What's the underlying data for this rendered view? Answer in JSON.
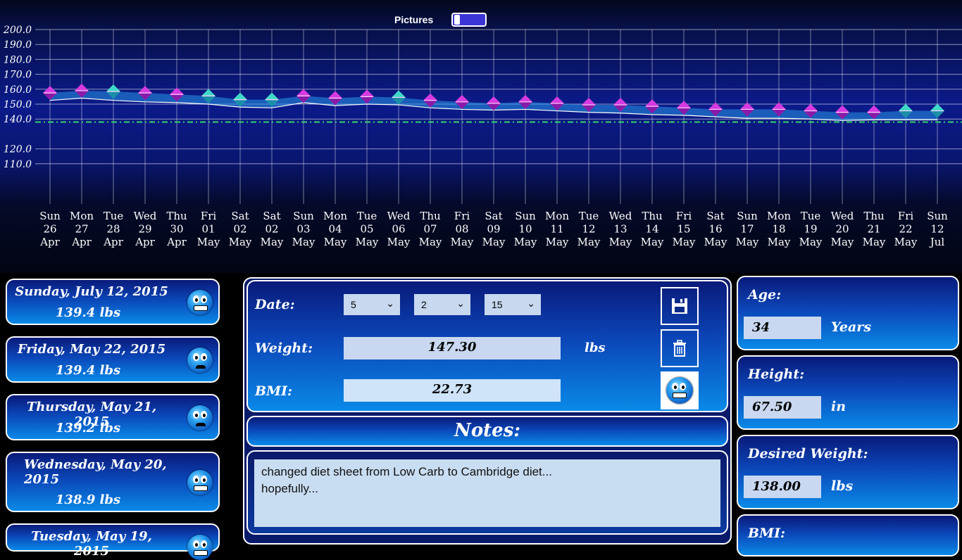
{
  "toolbar": {
    "pictures_label": "Pictures",
    "pictures_on": false
  },
  "chart_data": {
    "type": "line",
    "title": "",
    "xlabel": "",
    "ylabel": "",
    "ylim": [
      100,
      200
    ],
    "yticks": [
      "200.0",
      "190.0",
      "180.0",
      "170.0",
      "160.0",
      "150.0",
      "140.0",
      "120.0",
      "110.0"
    ],
    "target": 138,
    "grid": true,
    "categories": [
      [
        "Sun",
        "26",
        "Apr"
      ],
      [
        "Mon",
        "27",
        "Apr"
      ],
      [
        "Tue",
        "28",
        "Apr"
      ],
      [
        "Wed",
        "29",
        "Apr"
      ],
      [
        "Thu",
        "30",
        "Apr"
      ],
      [
        "Fri",
        "01",
        "May"
      ],
      [
        "Sat",
        "02",
        "May"
      ],
      [
        "Sat",
        "02",
        "May"
      ],
      [
        "Sun",
        "03",
        "May"
      ],
      [
        "Mon",
        "04",
        "May"
      ],
      [
        "Tue",
        "05",
        "May"
      ],
      [
        "Wed",
        "06",
        "May"
      ],
      [
        "Thu",
        "07",
        "May"
      ],
      [
        "Fri",
        "08",
        "May"
      ],
      [
        "Sat",
        "09",
        "May"
      ],
      [
        "Sun",
        "10",
        "May"
      ],
      [
        "Mon",
        "11",
        "May"
      ],
      [
        "Tue",
        "12",
        "May"
      ],
      [
        "Wed",
        "13",
        "May"
      ],
      [
        "Thu",
        "14",
        "May"
      ],
      [
        "Fri",
        "15",
        "May"
      ],
      [
        "Sat",
        "16",
        "May"
      ],
      [
        "Sun",
        "17",
        "May"
      ],
      [
        "Mon",
        "18",
        "May"
      ],
      [
        "Tue",
        "19",
        "May"
      ],
      [
        "Wed",
        "20",
        "May"
      ],
      [
        "Thu",
        "21",
        "May"
      ],
      [
        "Fri",
        "22",
        "May"
      ],
      [
        "Sun",
        "12",
        "Jul"
      ]
    ],
    "series": [
      {
        "values": [
          157.5,
          159,
          158.5,
          157.5,
          156.5,
          155.5,
          153,
          153,
          155.5,
          154,
          155,
          154.5,
          152.5,
          151.5,
          150.5,
          151.5,
          150.5,
          149.5,
          149.5,
          148.5,
          147.5,
          146.5,
          146.5,
          146.5,
          145.5,
          144.5,
          144.5,
          145.5,
          145.5
        ]
      }
    ],
    "trend": [
      152.5,
      154,
      152.5,
      151.5,
      151,
      150,
      148,
      147.5,
      151,
      149,
      150,
      149.5,
      147.5,
      146.5,
      146,
      146.5,
      145.5,
      144.5,
      144,
      143,
      142.5,
      141.5,
      140.5,
      140.5,
      140,
      139,
      139.5,
      139.5,
      139.5
    ],
    "marker_colors": [
      "magenta",
      "magenta",
      "teal",
      "magenta",
      "magenta",
      "teal",
      "teal",
      "teal",
      "magenta",
      "magenta",
      "magenta",
      "teal",
      "magenta",
      "magenta",
      "magenta",
      "magenta",
      "magenta",
      "magenta",
      "magenta",
      "magenta",
      "magenta",
      "magenta",
      "magenta",
      "magenta",
      "magenta",
      "magenta",
      "magenta",
      "teal",
      "teal"
    ]
  },
  "colors": {
    "magenta": "#d63ae0",
    "teal": "#3fd8c8",
    "target_line": "#36d46a",
    "trend_line": "#ffffff"
  },
  "history": [
    {
      "date": "Sunday, July 12, 2015",
      "weight": "139.4  lbs",
      "face": "happy"
    },
    {
      "date": "Friday, May 22, 2015",
      "weight": "139.4  lbs",
      "face": "sad"
    },
    {
      "date": "Thursday, May 21, 2015",
      "weight": "139.2  lbs",
      "face": "sad"
    },
    {
      "date": "Wednesday, May 20, 2015",
      "weight": "138.9  lbs",
      "face": "happy"
    },
    {
      "date": "Tuesday, May 19, 2015",
      "weight": "",
      "face": "happy"
    }
  ],
  "form": {
    "date_label": "Date:",
    "month": "5",
    "day": "2",
    "year": "15",
    "weight_label": "Weight:",
    "weight_value": "147.30",
    "weight_unit": "lbs",
    "bmi_label": "BMI:",
    "bmi_value": "22.73",
    "save_icon": "save-icon",
    "delete_icon": "trash-icon"
  },
  "notes": {
    "title": "Notes:",
    "text": "changed diet sheet from Low Carb to Cambridge diet...\nhopefully..."
  },
  "profile": {
    "age_label": "Age:",
    "age_value": "34",
    "age_unit": "Years",
    "height_label": "Height:",
    "height_value": "67.50",
    "height_unit": "in",
    "desired_label": "Desired Weight:",
    "desired_value": "138.00",
    "desired_unit": "lbs",
    "bmi_label": "BMI:"
  }
}
